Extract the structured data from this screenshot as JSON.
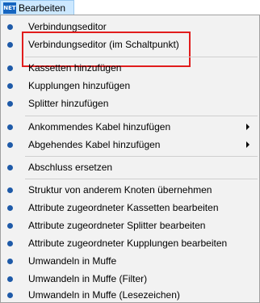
{
  "menubar": {
    "app_icon_text": "NET",
    "menu_title": "Bearbeiten"
  },
  "menu": {
    "items": [
      {
        "label": "Verbindungseditor"
      },
      {
        "label": "Verbindungseditor (im Schaltpunkt)"
      },
      {
        "label": "Kassetten hinzufügen"
      },
      {
        "label": "Kupplungen hinzufügen"
      },
      {
        "label": "Splitter hinzufügen"
      },
      {
        "label": "Ankommendes Kabel hinzufügen",
        "has_submenu": true
      },
      {
        "label": "Abgehendes Kabel hinzufügen",
        "has_submenu": true
      },
      {
        "label": "Abschluss ersetzen"
      },
      {
        "label": "Struktur von anderem Knoten übernehmen"
      },
      {
        "label": "Attribute zugeordneter Kassetten bearbeiten"
      },
      {
        "label": "Attribute zugeordneter Splitter bearbeiten"
      },
      {
        "label": "Attribute zugeordneter Kupplungen bearbeiten"
      },
      {
        "label": "Umwandeln in Muffe"
      },
      {
        "label": "Umwandeln in Muffe (Filter)"
      },
      {
        "label": "Umwandeln in Muffe (Lesezeichen)"
      }
    ]
  },
  "colors": {
    "bullet": "#1e5aa8",
    "highlight_box": "#e11d1d",
    "menu_title_bg": "#cce8ff",
    "dropdown_bg": "#f2f2f2"
  }
}
